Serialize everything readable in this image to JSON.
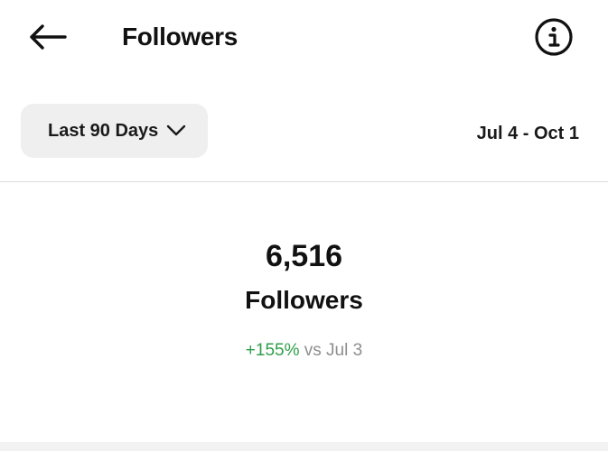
{
  "header": {
    "title": "Followers",
    "back_icon": "arrow-left-icon",
    "info_icon": "info-icon"
  },
  "filter": {
    "range_label": "Last 90 Days",
    "dropdown_icon": "chevron-down-icon",
    "date_range": "Jul 4 - Oct 1"
  },
  "stat": {
    "value": "6,516",
    "label": "Followers",
    "change_percent": "+155%",
    "change_suffix": " vs Jul 3"
  },
  "colors": {
    "positive": "#2f9e49",
    "muted": "#8e8e8e",
    "chip_bg": "#efefef"
  }
}
